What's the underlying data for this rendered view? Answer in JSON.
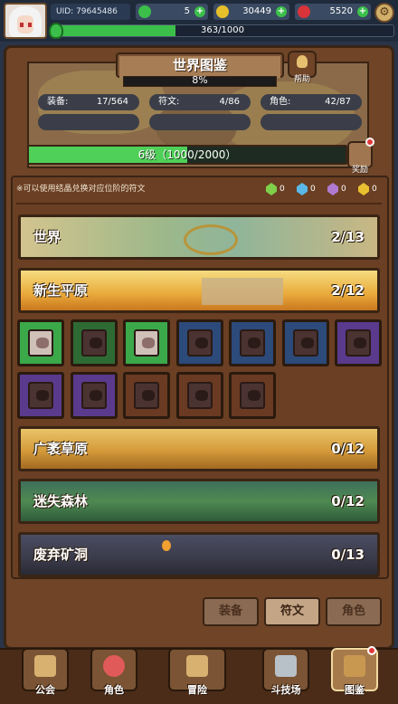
{
  "topbar": {
    "uid": "UID: 79645486",
    "resources": [
      {
        "icon": "clover-icon",
        "value": "5",
        "color": "#3bbf4a"
      },
      {
        "icon": "gold-coin-icon",
        "value": "30449",
        "color": "#e6c02a"
      },
      {
        "icon": "red-gem-icon",
        "value": "5520",
        "color": "#d8343a"
      }
    ],
    "xp": {
      "text": "363/1000",
      "fraction": 0.363
    }
  },
  "header": {
    "title": "世界图鉴",
    "percent": "8%",
    "help_label": "帮助",
    "stats": [
      {
        "label": "装备:",
        "value": "17/564"
      },
      {
        "label": "符文:",
        "value": "4/86"
      },
      {
        "label": "角色:",
        "value": "42/87"
      }
    ],
    "level_text": "6级（1000/2000）",
    "level_fraction": 0.5,
    "reward_label": "奖励"
  },
  "notice": "※可以使用结晶兑换对应位阶的符文",
  "crystals": [
    {
      "icon": "green-crystal-icon",
      "value": "0",
      "color": "#7fcf4a"
    },
    {
      "icon": "blue-crystal-icon",
      "value": "0",
      "color": "#5ab8e8"
    },
    {
      "icon": "purple-crystal-icon",
      "value": "0",
      "color": "#b07ad0"
    },
    {
      "icon": "gold-crystal-icon",
      "value": "0",
      "color": "#e8c030"
    }
  ],
  "regions": [
    {
      "name": "世界",
      "progress": "2/13"
    },
    {
      "name": "新生平原",
      "progress": "2/12"
    },
    {
      "name": "广袤草原",
      "progress": "0/12"
    },
    {
      "name": "迷失森林",
      "progress": "0/12"
    },
    {
      "name": "废弃矿洞",
      "progress": "0/13"
    }
  ],
  "rune_cards": [
    {
      "border": "#3ba84a",
      "lit": true
    },
    {
      "border": "#2e6a34",
      "lit": false
    },
    {
      "border": "#3ba84a",
      "lit": true
    },
    {
      "border": "#2c4a7a",
      "lit": false
    },
    {
      "border": "#2c4a7a",
      "lit": false
    },
    {
      "border": "#2c4a7a",
      "lit": false
    },
    {
      "border": "#5a3a8c",
      "lit": false
    },
    {
      "border": "#5a3a8c",
      "lit": false
    },
    {
      "border": "#5a3a8c",
      "lit": false
    },
    {
      "border": "#6a3a22",
      "lit": false
    },
    {
      "border": "#6a3a22",
      "lit": false
    },
    {
      "border": "#6a3a22",
      "lit": false
    }
  ],
  "tabs": [
    {
      "label": "装备",
      "active": false
    },
    {
      "label": "符文",
      "active": true
    },
    {
      "label": "角色",
      "active": false
    }
  ],
  "nav": [
    {
      "label": "公会",
      "icon": "guild-icon"
    },
    {
      "label": "角色",
      "icon": "character-icon"
    },
    {
      "label": "冒险",
      "icon": "adventure-map-icon"
    },
    {
      "label": "斗技场",
      "icon": "arena-swords-icon"
    },
    {
      "label": "图鉴",
      "icon": "codex-book-icon"
    }
  ]
}
